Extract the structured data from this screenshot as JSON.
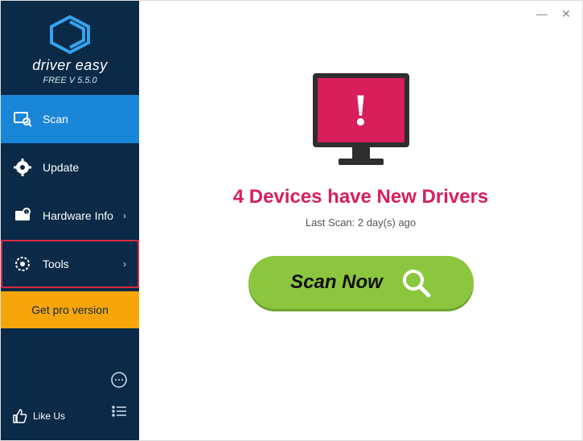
{
  "brand": {
    "name": "driver easy",
    "version": "FREE V 5.5.0"
  },
  "sidebar": {
    "items": [
      {
        "label": "Scan",
        "icon": "scan-icon",
        "selected": true,
        "chevron": false,
        "highlight": false
      },
      {
        "label": "Update",
        "icon": "gear-icon",
        "selected": false,
        "chevron": false,
        "highlight": false
      },
      {
        "label": "Hardware Info",
        "icon": "hardware-icon",
        "selected": false,
        "chevron": true,
        "highlight": false
      },
      {
        "label": "Tools",
        "icon": "tools-icon",
        "selected": false,
        "chevron": true,
        "highlight": true
      }
    ],
    "pro_label": "Get pro version",
    "like_label": "Like Us"
  },
  "main": {
    "headline": "4 Devices have New Drivers",
    "last_scan": "Last Scan: 2 day(s) ago",
    "scan_button": "Scan Now"
  },
  "colors": {
    "accent": "#1a86d8",
    "sidebar": "#0a2a47",
    "cta": "#8cc63f",
    "pro": "#f6a50a",
    "alert": "#d81e5b"
  }
}
